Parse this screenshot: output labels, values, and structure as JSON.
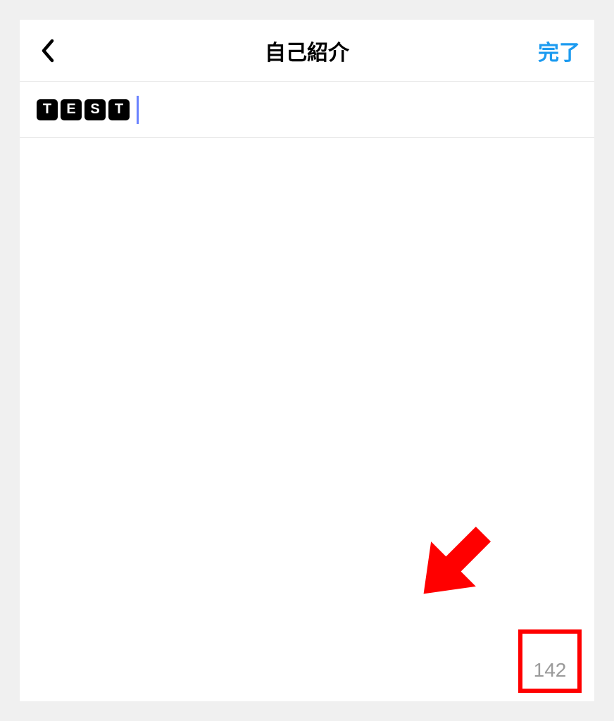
{
  "header": {
    "title": "自己紹介",
    "done_label": "完了"
  },
  "input": {
    "chars": [
      "T",
      "E",
      "S",
      "T"
    ]
  },
  "counter": {
    "remaining": "142"
  }
}
